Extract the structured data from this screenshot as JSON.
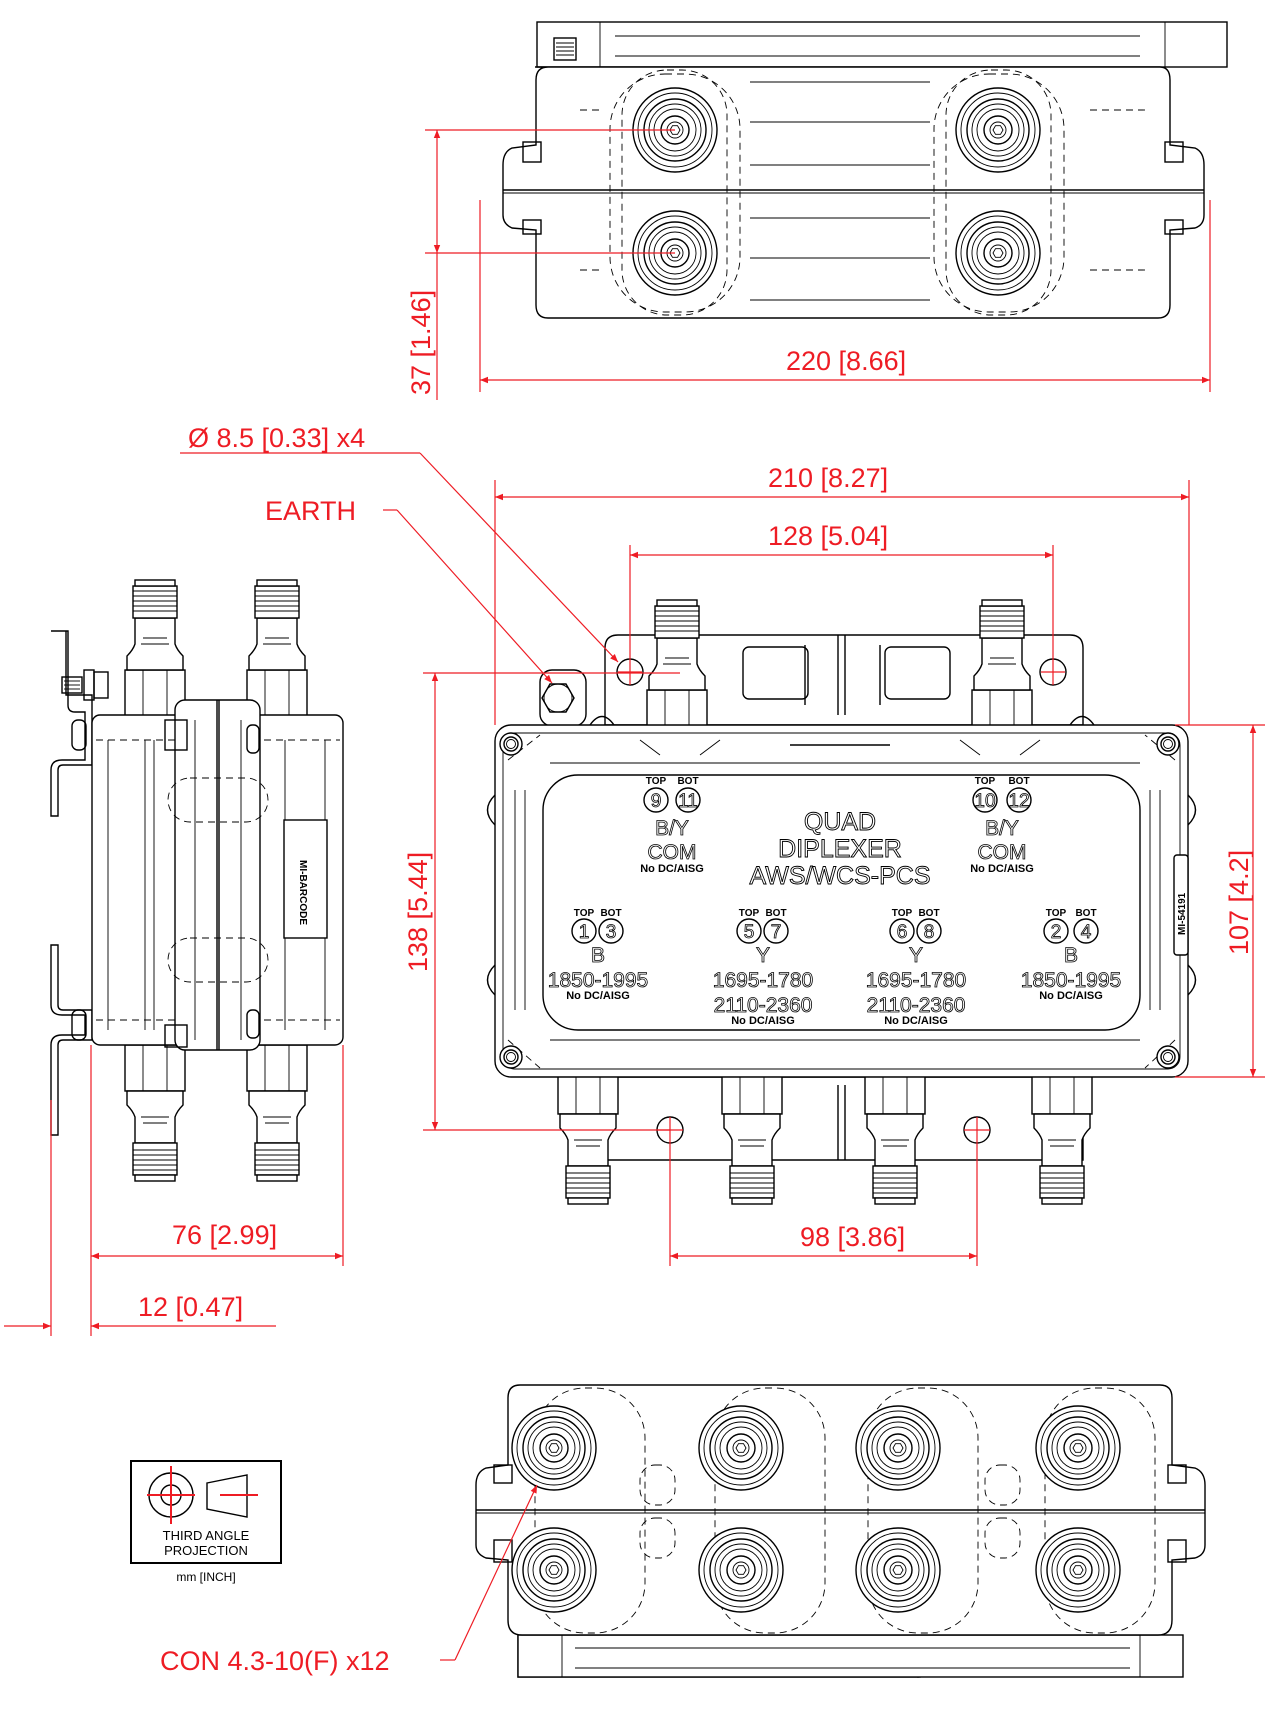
{
  "drawing": {
    "product_label": {
      "line1": "QUAD",
      "line2": "DIPLEXER",
      "line3": "AWS/WCS-PCS"
    },
    "port_groups": [
      {
        "id": "com-left",
        "top_label": "TOP",
        "bot_label": "BOT",
        "top_port": "9",
        "bot_port": "11",
        "band": "B/Y",
        "function": "COM",
        "freq1": "",
        "freq2": "",
        "note": "No DC/AISG"
      },
      {
        "id": "com-right",
        "top_label": "TOP",
        "bot_label": "BOT",
        "top_port": "10",
        "bot_port": "12",
        "band": "B/Y",
        "function": "COM",
        "freq1": "",
        "freq2": "",
        "note": "No DC/AISG"
      },
      {
        "id": "b-left",
        "top_label": "TOP",
        "bot_label": "BOT",
        "top_port": "1",
        "bot_port": "3",
        "band": "B",
        "freq1": "1850-1995",
        "freq2": "",
        "note": "No DC/AISG"
      },
      {
        "id": "y-left",
        "top_label": "TOP",
        "bot_label": "BOT",
        "top_port": "5",
        "bot_port": "7",
        "band": "Y",
        "freq1": "1695-1780",
        "freq2": "2110-2360",
        "note": "No DC/AISG"
      },
      {
        "id": "y-right",
        "top_label": "TOP",
        "bot_label": "BOT",
        "top_port": "6",
        "bot_port": "8",
        "band": "Y",
        "freq1": "1695-1780",
        "freq2": "2110-2360",
        "note": "No DC/AISG"
      },
      {
        "id": "b-right",
        "top_label": "TOP",
        "bot_label": "BOT",
        "top_port": "2",
        "bot_port": "4",
        "band": "B",
        "freq1": "1850-1995",
        "freq2": "",
        "note": "No DC/AISG"
      }
    ],
    "part_number_label": "MI-54191",
    "side_label": "MI-BARCODE",
    "dimensions": {
      "top_view_depth": "37 [1.46]",
      "top_view_width": "220 [8.66]",
      "hole": "Ø 8.5 [0.33]  x4",
      "earth": "EARTH",
      "front_width": "210 [8.27]",
      "hole_spacing_top": "128 [5.04]",
      "front_height": "138 [5.44]",
      "body_height": "107 [4.2]",
      "side_width": "76 [2.99]",
      "bracket_offset": "12 [0.47]",
      "hole_spacing_bottom": "98 [3.86]",
      "connector_callout": "CON 4.3-10(F) x12"
    },
    "projection_block": {
      "line1": "THIRD ANGLE",
      "line2": "PROJECTION",
      "units": "mm [INCH]"
    },
    "colors": {
      "dimension": "#ee1c24",
      "outline": "#000000"
    }
  }
}
